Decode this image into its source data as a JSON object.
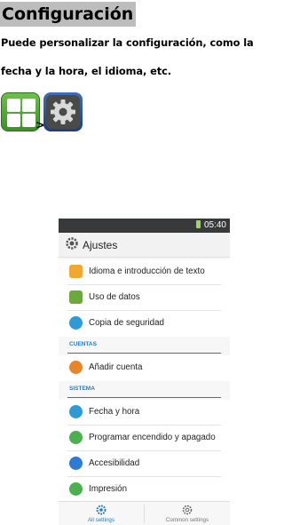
{
  "document": {
    "title": "Configuración",
    "line1": "Puede personalizar la configuración, como la",
    "line2": "fecha y la hora, el idioma, etc.",
    "arrow": ">"
  },
  "phone": {
    "status_time": "05:40",
    "action_title": "Ajustes",
    "rows": [
      {
        "label": "Idioma e introducción de texto",
        "icon": "language-icon",
        "color": "#f0a830"
      },
      {
        "label": "Uso de datos",
        "icon": "data-usage-icon",
        "color": "#6aaa3a"
      },
      {
        "label": "Copia de seguridad",
        "icon": "backup-icon",
        "color": "#2e9ad6"
      },
      {
        "label": "Añadir cuenta",
        "icon": "add-account-icon",
        "color": "#e8852a"
      },
      {
        "label": "Fecha y hora",
        "icon": "clock-icon",
        "color": "#2e9ad6"
      },
      {
        "label": "Programar encendido y apagado",
        "icon": "power-icon",
        "color": "#4caf50"
      },
      {
        "label": "Accesibilidad",
        "icon": "accessibility-icon",
        "color": "#2e7ad6"
      },
      {
        "label": "Impresión",
        "icon": "print-icon",
        "color": "#4caf50"
      }
    ],
    "sections": {
      "accounts": "CUENTAS",
      "system": "SISTEMA"
    },
    "tabs": {
      "all": "All settings",
      "common": "Common settings"
    },
    "accent_color": "#1f7cc9"
  }
}
